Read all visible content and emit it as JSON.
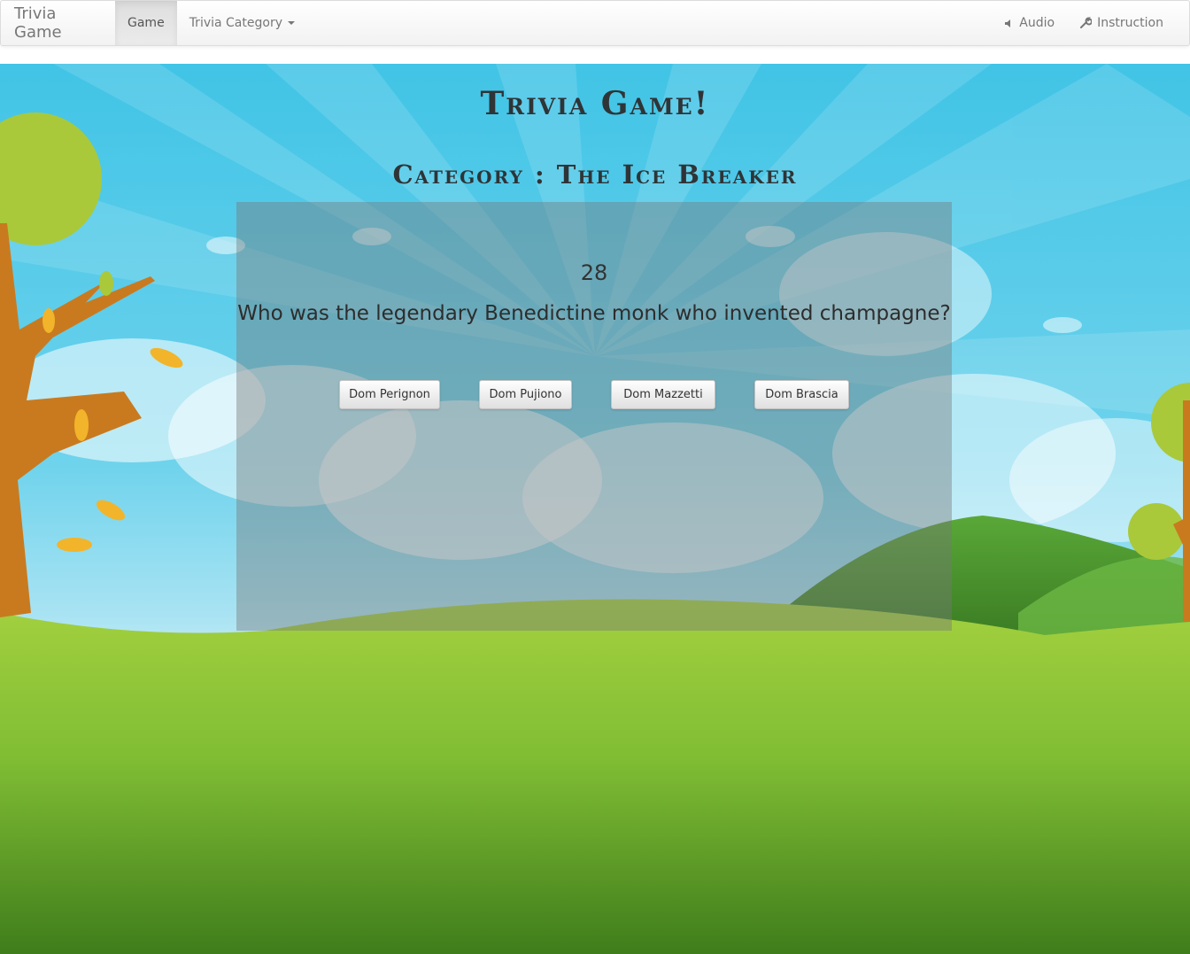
{
  "navbar": {
    "brand": "Trivia Game",
    "game_label": "Game",
    "category_menu_label": "Trivia Category",
    "audio_label": "Audio",
    "instruction_label": "Instruction"
  },
  "game": {
    "title": "Trivia Game!",
    "category_text": "Category : The Ice Breaker",
    "timer": "28",
    "question": "Who was the legendary Benedictine monk who invented champagne?",
    "answers": [
      "Dom Perignon",
      "Dom Pujiono",
      "Dom Mazzetti",
      "Dom Brascia"
    ]
  },
  "colors": {
    "sky": "#41c4e6",
    "grass": "#8cc43c",
    "tree_trunk": "#c97a1f",
    "leaf": "#a9c93a"
  },
  "icons": {
    "audio": "speaker-icon",
    "instruction": "wrench-icon",
    "dropdown": "caret-down-icon"
  }
}
